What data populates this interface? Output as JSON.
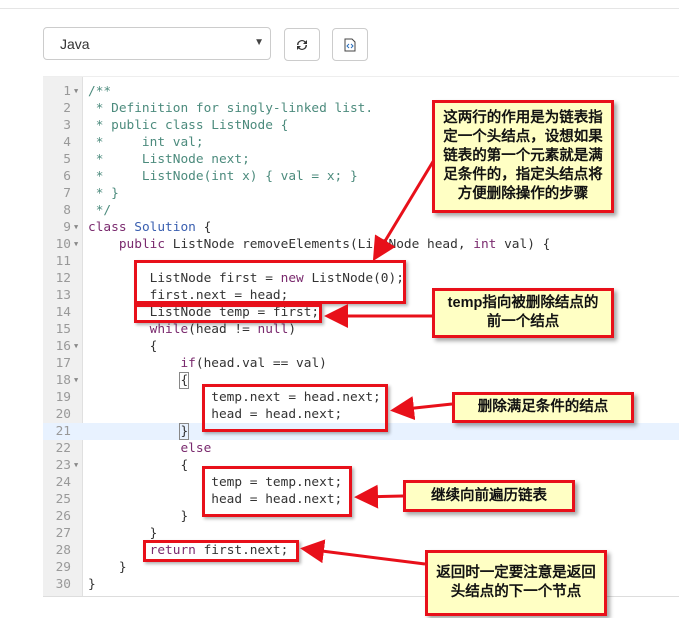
{
  "toolbar": {
    "language": "Java",
    "reset_icon": "refresh-icon",
    "format_icon": "code-file-icon"
  },
  "editor": {
    "active_line": 21,
    "lines": [
      {
        "n": "1",
        "fold": true,
        "t": [
          [
            "cm",
            "/**"
          ]
        ]
      },
      {
        "n": "2",
        "t": [
          [
            "cm",
            " * Definition for singly-linked list."
          ]
        ]
      },
      {
        "n": "3",
        "t": [
          [
            "cm",
            " * public class ListNode {"
          ]
        ]
      },
      {
        "n": "4",
        "t": [
          [
            "cm",
            " *     int val;"
          ]
        ]
      },
      {
        "n": "5",
        "t": [
          [
            "cm",
            " *     ListNode next;"
          ]
        ]
      },
      {
        "n": "6",
        "t": [
          [
            "cm",
            " *     ListNode(int x) { val = x; }"
          ]
        ]
      },
      {
        "n": "7",
        "t": [
          [
            "cm",
            " * }"
          ]
        ]
      },
      {
        "n": "8",
        "t": [
          [
            "cm",
            " */"
          ]
        ]
      },
      {
        "n": "9",
        "fold": true,
        "t": [
          [
            "kw",
            "class "
          ],
          [
            "ty",
            "Solution"
          ],
          [
            "pl",
            " {"
          ]
        ]
      },
      {
        "n": "10",
        "fold": true,
        "t": [
          [
            "pl",
            "    "
          ],
          [
            "kw",
            "public"
          ],
          [
            "pl",
            " ListNode removeElements(ListNode head, "
          ],
          [
            "kw",
            "int"
          ],
          [
            "pl",
            " val) {"
          ]
        ]
      },
      {
        "n": "11",
        "t": [
          [
            "pl",
            ""
          ]
        ]
      },
      {
        "n": "12",
        "t": [
          [
            "pl",
            "        ListNode first = "
          ],
          [
            "kw",
            "new"
          ],
          [
            "pl",
            " ListNode(0);"
          ]
        ]
      },
      {
        "n": "13",
        "t": [
          [
            "pl",
            "        first.next = head;"
          ]
        ]
      },
      {
        "n": "14",
        "t": [
          [
            "pl",
            "        ListNode temp = first;"
          ]
        ]
      },
      {
        "n": "15",
        "t": [
          [
            "pl",
            "        "
          ],
          [
            "kw",
            "while"
          ],
          [
            "pl",
            "(head != "
          ],
          [
            "kw",
            "null"
          ],
          [
            "pl",
            ")"
          ]
        ]
      },
      {
        "n": "16",
        "fold": true,
        "t": [
          [
            "pl",
            "        {"
          ]
        ]
      },
      {
        "n": "17",
        "t": [
          [
            "pl",
            "            "
          ],
          [
            "kw",
            "if"
          ],
          [
            "pl",
            "(head.val == val)"
          ]
        ]
      },
      {
        "n": "18",
        "fold": true,
        "t": [
          [
            "pl",
            "            "
          ],
          [
            "br",
            "{"
          ]
        ]
      },
      {
        "n": "19",
        "t": [
          [
            "pl",
            "                temp.next = head.next;"
          ]
        ]
      },
      {
        "n": "20",
        "t": [
          [
            "pl",
            "                head = head.next;"
          ]
        ]
      },
      {
        "n": "21",
        "t": [
          [
            "pl",
            "            "
          ],
          [
            "br",
            "}"
          ]
        ]
      },
      {
        "n": "22",
        "t": [
          [
            "pl",
            "            "
          ],
          [
            "kw",
            "else"
          ]
        ]
      },
      {
        "n": "23",
        "fold": true,
        "t": [
          [
            "pl",
            "            {"
          ]
        ]
      },
      {
        "n": "24",
        "t": [
          [
            "pl",
            "                temp = temp.next;"
          ]
        ]
      },
      {
        "n": "25",
        "t": [
          [
            "pl",
            "                head = head.next;"
          ]
        ]
      },
      {
        "n": "26",
        "t": [
          [
            "pl",
            "            }"
          ]
        ]
      },
      {
        "n": "27",
        "t": [
          [
            "pl",
            "        }"
          ]
        ]
      },
      {
        "n": "28",
        "t": [
          [
            "pl",
            "        "
          ],
          [
            "kw",
            "return"
          ],
          [
            "pl",
            " first.next;"
          ]
        ]
      },
      {
        "n": "29",
        "t": [
          [
            "pl",
            "    }"
          ]
        ]
      },
      {
        "n": "30",
        "t": [
          [
            "pl",
            "}"
          ]
        ]
      }
    ]
  },
  "annotations": {
    "head_node": "这两行的作用是为链表指定一个头结点，设想如果链表的第一个元素就是满足条件的，指定头结点将方便删除操作的步骤",
    "temp": "temp指向被删除结点的前一个结点",
    "delete": "删除满足条件的结点",
    "continue": "继续向前遍历链表",
    "return": "返回时一定要注意是返回头结点的下一个节点"
  },
  "colors": {
    "accent_red": "#e8101a",
    "note_bg": "#ffffc4"
  }
}
